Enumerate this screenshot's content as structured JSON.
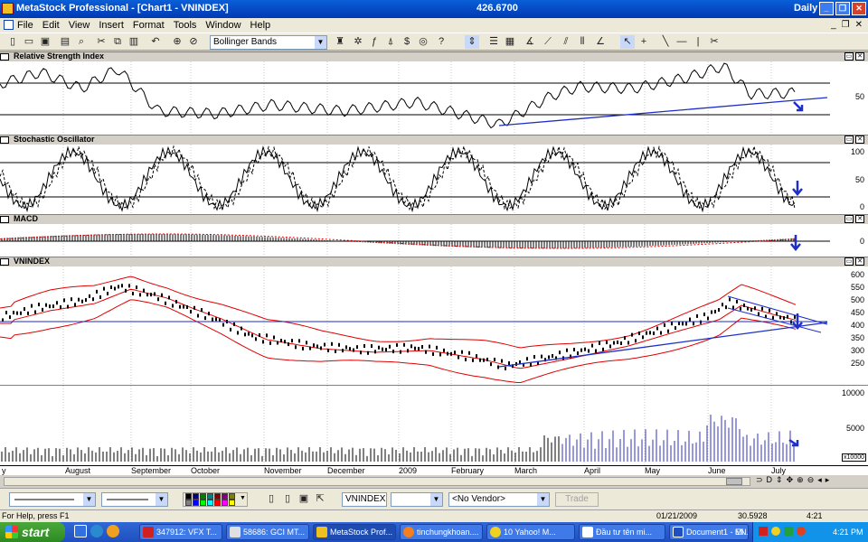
{
  "window": {
    "title": "MetaStock Professional - [Chart1 - VNINDEX]",
    "last_price": "426.6700",
    "periodicity": "Daily"
  },
  "menu": [
    "File",
    "Edit",
    "View",
    "Insert",
    "Format",
    "Tools",
    "Window",
    "Help"
  ],
  "toolbar": {
    "indicator_combo": "Bollinger Bands"
  },
  "panels": {
    "rsi": {
      "name": "Relative Strength Index",
      "ytick": "50"
    },
    "stoch": {
      "name": "Stochastic Oscillator",
      "yticks": [
        "100",
        "50",
        "0"
      ]
    },
    "macd": {
      "name": "MACD",
      "ytick": "0"
    },
    "price": {
      "name": "VNINDEX",
      "yticks": [
        "600",
        "550",
        "500",
        "450",
        "400",
        "350",
        "300",
        "250"
      ]
    },
    "volume": {
      "yticks": [
        "10000",
        "5000"
      ],
      "scale": "x10000"
    }
  },
  "xaxis": [
    "y",
    "August",
    "September",
    "October",
    "November",
    "December",
    "2009",
    "February",
    "March",
    "April",
    "May",
    "June",
    "July"
  ],
  "bottombar": {
    "symbol": "VNINDEX",
    "vendor": "<No Vendor>",
    "trade": "Trade"
  },
  "status": {
    "help": "For Help, press F1",
    "date": "01/21/2009",
    "value": "30.5928",
    "time": "4:21"
  },
  "taskbar": {
    "start": "start",
    "tasks": [
      "347912: VFX T...",
      "58686: GCI MT...",
      "MetaStock Prof...",
      "tinchungkhoan....",
      "10 Yahoo! M...",
      "Đầu tư tên mi...",
      "Document1 - Mi..."
    ],
    "lang": "EN",
    "clock": "4:21 PM"
  },
  "colors": {
    "bands": "#e00000",
    "trend": "#1e2ec8",
    "volume": "#3030c0",
    "arrow": "#1e2ec8"
  }
}
